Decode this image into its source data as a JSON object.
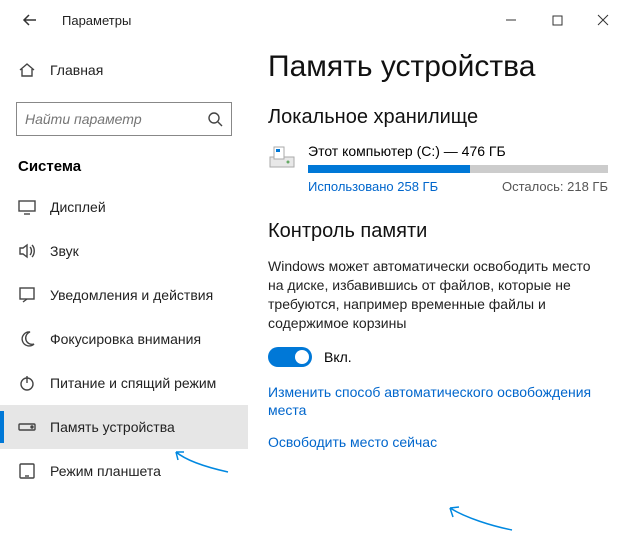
{
  "window": {
    "title": "Параметры"
  },
  "sidebar": {
    "home_label": "Главная",
    "search_placeholder": "Найти параметр",
    "section_label": "Система",
    "items": [
      {
        "label": "Дисплей"
      },
      {
        "label": "Звук"
      },
      {
        "label": "Уведомления и действия"
      },
      {
        "label": "Фокусировка внимания"
      },
      {
        "label": "Питание и спящий режим"
      },
      {
        "label": "Память устройства"
      },
      {
        "label": "Режим планшета"
      }
    ]
  },
  "content": {
    "page_title": "Память устройства",
    "local_storage_heading": "Локальное хранилище",
    "disk": {
      "title": "Этот компьютер (C:) — 476 ГБ",
      "used_label": "Использовано 258 ГБ",
      "remaining_label": "Осталось: 218 ГБ",
      "fill_percent": 54
    },
    "sense_heading": "Контроль памяти",
    "sense_desc": "Windows может автоматически освободить место на диске, избавившись от файлов, которые не требуются, например временные файлы и содержимое корзины",
    "toggle_label": "Вкл.",
    "link_change": "Изменить способ автоматического освобождения места",
    "link_free_now": "Освободить место сейчас"
  }
}
